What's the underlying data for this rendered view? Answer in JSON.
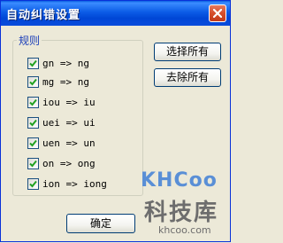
{
  "window": {
    "title": "自动纠错设置"
  },
  "group": {
    "label": "规则",
    "rules": [
      {
        "text": "gn => ng",
        "checked": true
      },
      {
        "text": "mg => ng",
        "checked": true
      },
      {
        "text": "iou => iu",
        "checked": true
      },
      {
        "text": "uei => ui",
        "checked": true
      },
      {
        "text": "uen => un",
        "checked": true
      },
      {
        "text": "on => ong",
        "checked": true
      },
      {
        "text": "ion => iong",
        "checked": true
      }
    ]
  },
  "buttons": {
    "select_all": "选择所有",
    "remove_all": "去除所有",
    "ok": "确定"
  },
  "watermark": {
    "logo": "KHCoo",
    "name": "科技库",
    "url": "khcoo.com"
  },
  "colors": {
    "titlebar": "#0a5fe0",
    "group_label": "#1c3fb9",
    "checkmark": "#21a121"
  }
}
